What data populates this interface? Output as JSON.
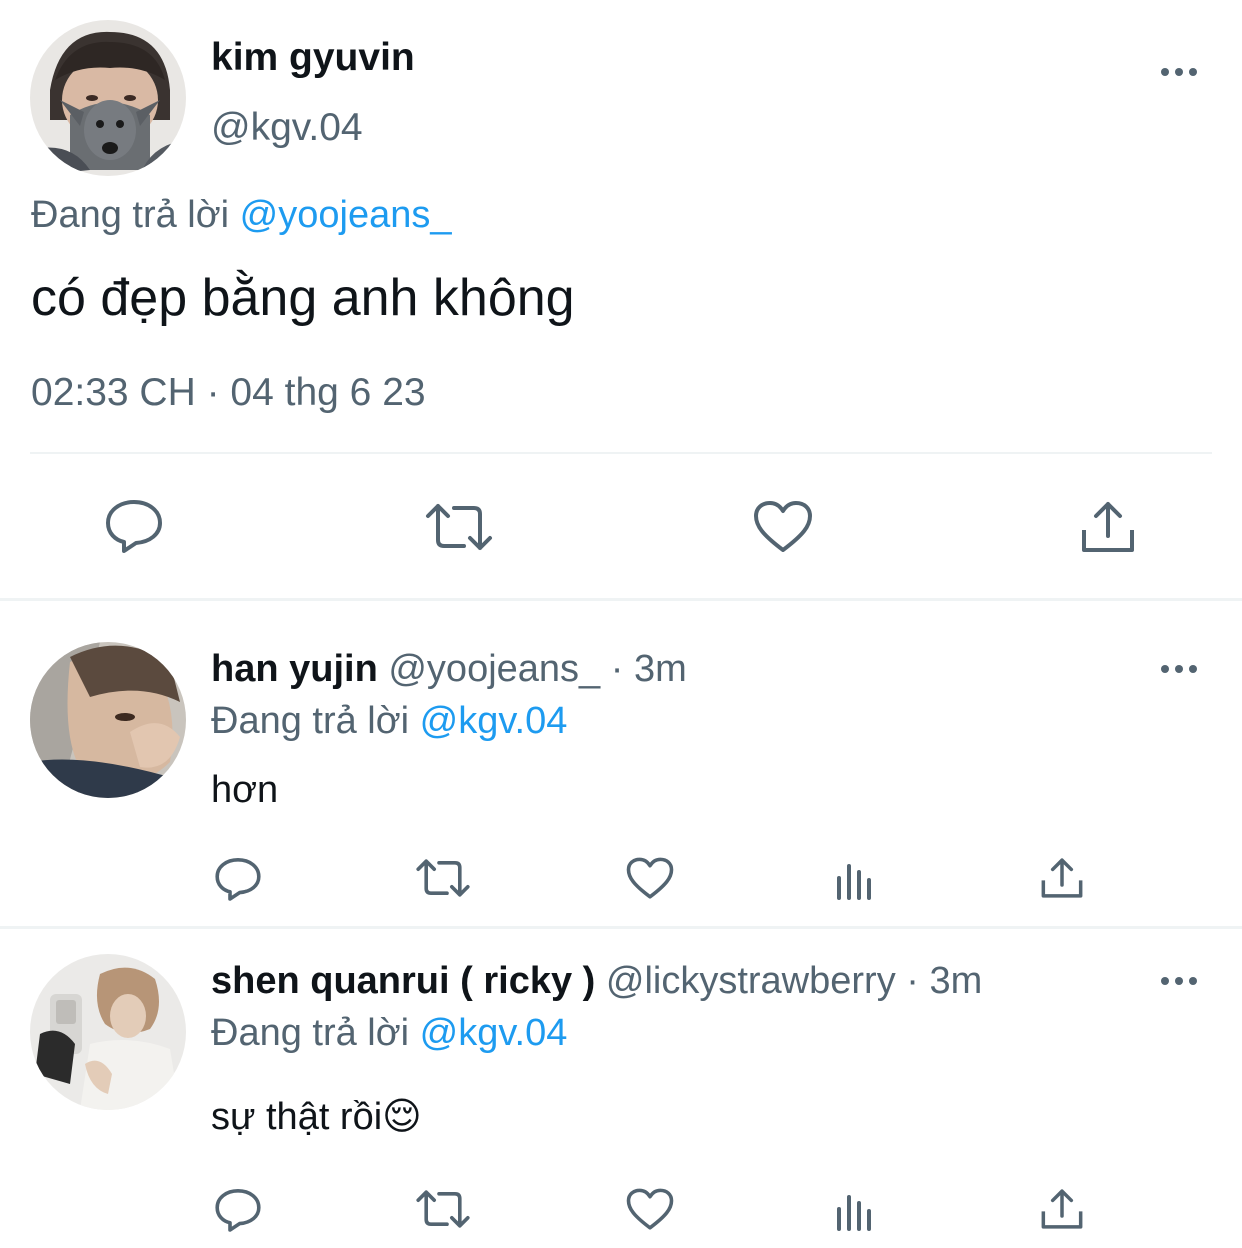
{
  "main_tweet": {
    "display_name": "kim gyuvin",
    "handle": "@kgv.04",
    "replying_prefix": "Đang trả lời",
    "replying_to": "@yoojeans_",
    "text": "có đẹp bằng anh không",
    "timestamp": "02:33 CH · 04 thg 6 23"
  },
  "replies": [
    {
      "display_name": "han yujin",
      "handle": "@yoojeans_",
      "time": "· 3m",
      "replying_prefix": "Đang trả lời",
      "replying_to": "@kgv.04",
      "text": "hơn"
    },
    {
      "display_name": "shen quanrui ( ricky )",
      "handle": "@lickystrawberry",
      "time": "· 3m",
      "replying_prefix": "Đang trả lời",
      "replying_to": "@kgv.04",
      "text": "sự thật rồi😌"
    }
  ],
  "icons": {
    "reply": "reply-icon",
    "retweet": "retweet-icon",
    "like": "like-icon",
    "views": "views-icon",
    "share": "share-icon",
    "more": "more-icon"
  },
  "colors": {
    "text": "#0f1419",
    "secondary": "#536471",
    "link": "#1d9bf0",
    "divider": "#eff3f4"
  }
}
